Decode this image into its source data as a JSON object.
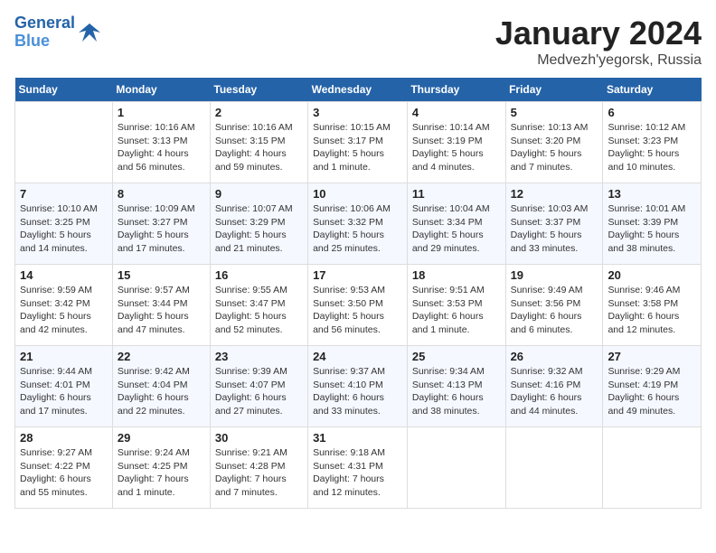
{
  "header": {
    "logo_line1": "General",
    "logo_line2": "Blue",
    "month": "January 2024",
    "location": "Medvezh'yegorsk, Russia"
  },
  "weekdays": [
    "Sunday",
    "Monday",
    "Tuesday",
    "Wednesday",
    "Thursday",
    "Friday",
    "Saturday"
  ],
  "weeks": [
    [
      {
        "day": "",
        "info": ""
      },
      {
        "day": "1",
        "info": "Sunrise: 10:16 AM\nSunset: 3:13 PM\nDaylight: 4 hours\nand 56 minutes."
      },
      {
        "day": "2",
        "info": "Sunrise: 10:16 AM\nSunset: 3:15 PM\nDaylight: 4 hours\nand 59 minutes."
      },
      {
        "day": "3",
        "info": "Sunrise: 10:15 AM\nSunset: 3:17 PM\nDaylight: 5 hours\nand 1 minute."
      },
      {
        "day": "4",
        "info": "Sunrise: 10:14 AM\nSunset: 3:19 PM\nDaylight: 5 hours\nand 4 minutes."
      },
      {
        "day": "5",
        "info": "Sunrise: 10:13 AM\nSunset: 3:20 PM\nDaylight: 5 hours\nand 7 minutes."
      },
      {
        "day": "6",
        "info": "Sunrise: 10:12 AM\nSunset: 3:23 PM\nDaylight: 5 hours\nand 10 minutes."
      }
    ],
    [
      {
        "day": "7",
        "info": "Sunrise: 10:10 AM\nSunset: 3:25 PM\nDaylight: 5 hours\nand 14 minutes."
      },
      {
        "day": "8",
        "info": "Sunrise: 10:09 AM\nSunset: 3:27 PM\nDaylight: 5 hours\nand 17 minutes."
      },
      {
        "day": "9",
        "info": "Sunrise: 10:07 AM\nSunset: 3:29 PM\nDaylight: 5 hours\nand 21 minutes."
      },
      {
        "day": "10",
        "info": "Sunrise: 10:06 AM\nSunset: 3:32 PM\nDaylight: 5 hours\nand 25 minutes."
      },
      {
        "day": "11",
        "info": "Sunrise: 10:04 AM\nSunset: 3:34 PM\nDaylight: 5 hours\nand 29 minutes."
      },
      {
        "day": "12",
        "info": "Sunrise: 10:03 AM\nSunset: 3:37 PM\nDaylight: 5 hours\nand 33 minutes."
      },
      {
        "day": "13",
        "info": "Sunrise: 10:01 AM\nSunset: 3:39 PM\nDaylight: 5 hours\nand 38 minutes."
      }
    ],
    [
      {
        "day": "14",
        "info": "Sunrise: 9:59 AM\nSunset: 3:42 PM\nDaylight: 5 hours\nand 42 minutes."
      },
      {
        "day": "15",
        "info": "Sunrise: 9:57 AM\nSunset: 3:44 PM\nDaylight: 5 hours\nand 47 minutes."
      },
      {
        "day": "16",
        "info": "Sunrise: 9:55 AM\nSunset: 3:47 PM\nDaylight: 5 hours\nand 52 minutes."
      },
      {
        "day": "17",
        "info": "Sunrise: 9:53 AM\nSunset: 3:50 PM\nDaylight: 5 hours\nand 56 minutes."
      },
      {
        "day": "18",
        "info": "Sunrise: 9:51 AM\nSunset: 3:53 PM\nDaylight: 6 hours\nand 1 minute."
      },
      {
        "day": "19",
        "info": "Sunrise: 9:49 AM\nSunset: 3:56 PM\nDaylight: 6 hours\nand 6 minutes."
      },
      {
        "day": "20",
        "info": "Sunrise: 9:46 AM\nSunset: 3:58 PM\nDaylight: 6 hours\nand 12 minutes."
      }
    ],
    [
      {
        "day": "21",
        "info": "Sunrise: 9:44 AM\nSunset: 4:01 PM\nDaylight: 6 hours\nand 17 minutes."
      },
      {
        "day": "22",
        "info": "Sunrise: 9:42 AM\nSunset: 4:04 PM\nDaylight: 6 hours\nand 22 minutes."
      },
      {
        "day": "23",
        "info": "Sunrise: 9:39 AM\nSunset: 4:07 PM\nDaylight: 6 hours\nand 27 minutes."
      },
      {
        "day": "24",
        "info": "Sunrise: 9:37 AM\nSunset: 4:10 PM\nDaylight: 6 hours\nand 33 minutes."
      },
      {
        "day": "25",
        "info": "Sunrise: 9:34 AM\nSunset: 4:13 PM\nDaylight: 6 hours\nand 38 minutes."
      },
      {
        "day": "26",
        "info": "Sunrise: 9:32 AM\nSunset: 4:16 PM\nDaylight: 6 hours\nand 44 minutes."
      },
      {
        "day": "27",
        "info": "Sunrise: 9:29 AM\nSunset: 4:19 PM\nDaylight: 6 hours\nand 49 minutes."
      }
    ],
    [
      {
        "day": "28",
        "info": "Sunrise: 9:27 AM\nSunset: 4:22 PM\nDaylight: 6 hours\nand 55 minutes."
      },
      {
        "day": "29",
        "info": "Sunrise: 9:24 AM\nSunset: 4:25 PM\nDaylight: 7 hours\nand 1 minute."
      },
      {
        "day": "30",
        "info": "Sunrise: 9:21 AM\nSunset: 4:28 PM\nDaylight: 7 hours\nand 7 minutes."
      },
      {
        "day": "31",
        "info": "Sunrise: 9:18 AM\nSunset: 4:31 PM\nDaylight: 7 hours\nand 12 minutes."
      },
      {
        "day": "",
        "info": ""
      },
      {
        "day": "",
        "info": ""
      },
      {
        "day": "",
        "info": ""
      }
    ]
  ]
}
